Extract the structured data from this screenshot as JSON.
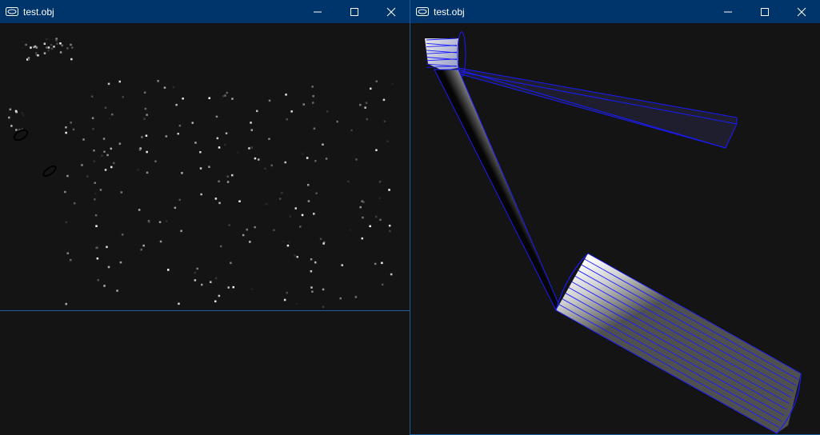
{
  "windows": {
    "left": {
      "title": "test.obj"
    },
    "right": {
      "title": "test.obj"
    }
  },
  "colors": {
    "titlebar": "#00356b",
    "viewport_bg": "#141414",
    "wireframe": "#1a1aff",
    "window_border": "#1b5e9b"
  },
  "icons": [
    "app-icon",
    "minimize-icon",
    "maximize-icon",
    "close-icon"
  ]
}
